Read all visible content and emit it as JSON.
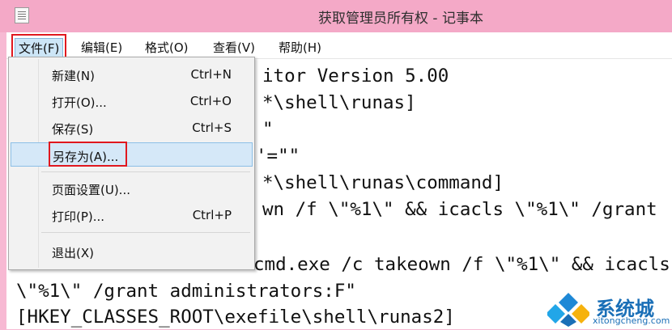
{
  "window": {
    "title": "获取管理员所有权 - 记事本"
  },
  "menubar": {
    "items": [
      {
        "label": "文件(F)"
      },
      {
        "label": "编辑(E)"
      },
      {
        "label": "格式(O)"
      },
      {
        "label": "查看(V)"
      },
      {
        "label": "帮助(H)"
      }
    ]
  },
  "file_menu": {
    "items": [
      {
        "label": "新建(N)",
        "shortcut": "Ctrl+N"
      },
      {
        "label": "打开(O)...",
        "shortcut": "Ctrl+O"
      },
      {
        "label": "保存(S)",
        "shortcut": "Ctrl+S"
      },
      {
        "label": "另存为(A)...",
        "shortcut": ""
      },
      {
        "label": "页面设置(U)...",
        "shortcut": ""
      },
      {
        "label": "打印(P)...",
        "shortcut": "Ctrl+P"
      },
      {
        "label": "退出(X)",
        "shortcut": ""
      }
    ],
    "selected_item": "另存为(A)..."
  },
  "editor": {
    "lines": [
      "itor Version 5.00",
      "*\\shell\\runas]",
      "\"",
      "'=\"\"",
      "*\\shell\\runas\\command]",
      "wn /f \\\"%1\\\" && icacls \\\"%1\\\" /grant",
      "cmd.exe /c takeown /f \\\"%1\\\" && icacls",
      "\\\"%1\\\" /grant administrators:F\"",
      "[HKEY_CLASSES_ROOT\\exefile\\shell\\runas2]"
    ]
  },
  "watermark": {
    "brand": "系统城",
    "url": "xitongcheng.com"
  },
  "colors": {
    "titlebar": "#f4a9c7",
    "highlight_box": "#e0181f",
    "menu_selection": "#d5e8f8"
  }
}
